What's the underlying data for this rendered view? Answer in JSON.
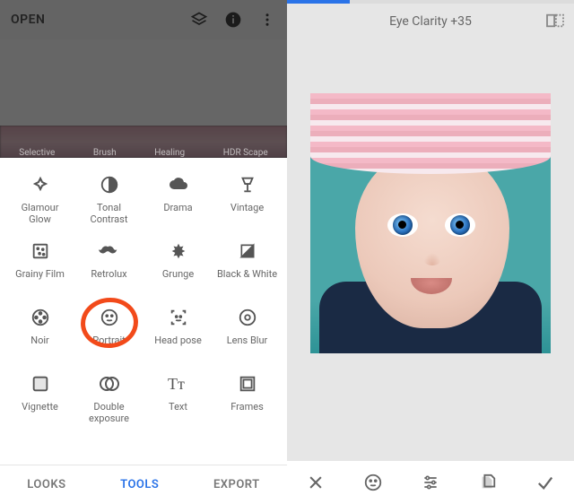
{
  "left": {
    "open_label": "OPEN",
    "strip_tabs": [
      "Selective",
      "Brush",
      "Healing",
      "HDR Scape"
    ],
    "tools": [
      {
        "key": "glamour-glow",
        "label": "Glamour Glow"
      },
      {
        "key": "tonal-contrast",
        "label": "Tonal Contrast"
      },
      {
        "key": "drama",
        "label": "Drama"
      },
      {
        "key": "vintage",
        "label": "Vintage"
      },
      {
        "key": "grainy-film",
        "label": "Grainy Film"
      },
      {
        "key": "retrolux",
        "label": "Retrolux"
      },
      {
        "key": "grunge",
        "label": "Grunge"
      },
      {
        "key": "black-white",
        "label": "Black & White"
      },
      {
        "key": "noir",
        "label": "Noir"
      },
      {
        "key": "portrait",
        "label": "Portrait",
        "highlighted": true
      },
      {
        "key": "head-pose",
        "label": "Head pose"
      },
      {
        "key": "lens-blur",
        "label": "Lens Blur"
      },
      {
        "key": "vignette",
        "label": "Vignette"
      },
      {
        "key": "double-exposure",
        "label": "Double exposure"
      },
      {
        "key": "text",
        "label": "Text"
      },
      {
        "key": "frames",
        "label": "Frames"
      }
    ],
    "bottom_tabs": {
      "looks": "LOOKS",
      "tools": "TOOLS",
      "export": "EXPORT",
      "active": "tools"
    }
  },
  "right": {
    "title": "Eye Clarity +35",
    "progress_pct": 22
  }
}
